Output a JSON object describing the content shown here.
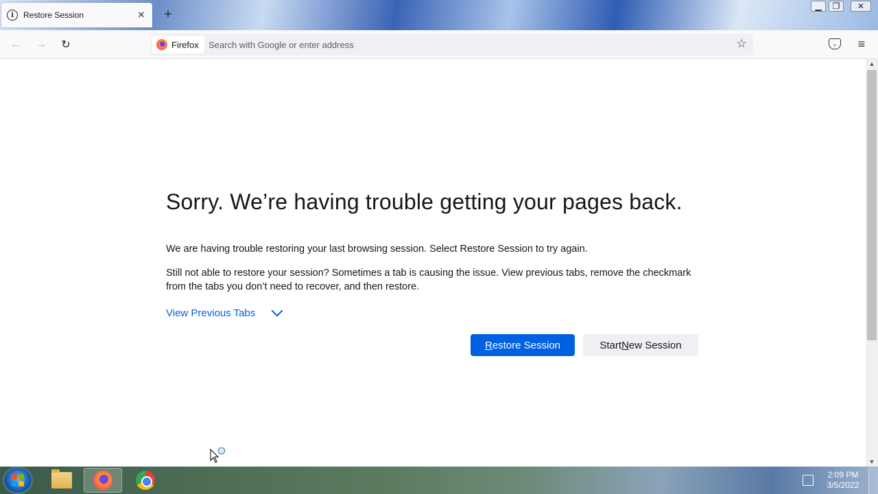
{
  "tab": {
    "title": "Restore Session"
  },
  "navbar": {
    "identity_label": "Firefox",
    "url_placeholder": "Search with Google or enter address"
  },
  "icons": {
    "tab": "info-icon",
    "tab_close": "close-icon",
    "new_tab": "plus-icon",
    "back": "back-arrow-icon",
    "forward": "forward-arrow-icon",
    "reload": "reload-icon",
    "bookmark": "star-icon",
    "pocket": "pocket-icon",
    "menu": "hamburger-menu-icon"
  },
  "page": {
    "heading": "Sorry. We’re having trouble getting your pages back.",
    "paragraph1": "We are having trouble restoring your last browsing session. Select Restore Session to try again.",
    "paragraph2": "Still not able to restore your session? Sometimes a tab is causing the issue. View previous tabs, remove the checkmark from the tabs you don’t need to recover, and then restore.",
    "view_previous_tabs": "View Previous Tabs",
    "restore_session": {
      "prefix": "",
      "accel": "R",
      "rest": "estore Session"
    },
    "start_new_session": {
      "prefix": "Start ",
      "accel": "N",
      "rest": "ew Session"
    }
  },
  "taskbar": {
    "time": "2:09 PM",
    "date": "3/5/2022"
  },
  "colors": {
    "accent": "#0061e0",
    "secondary_button": "#f0f0f4",
    "text": "#15141a"
  }
}
